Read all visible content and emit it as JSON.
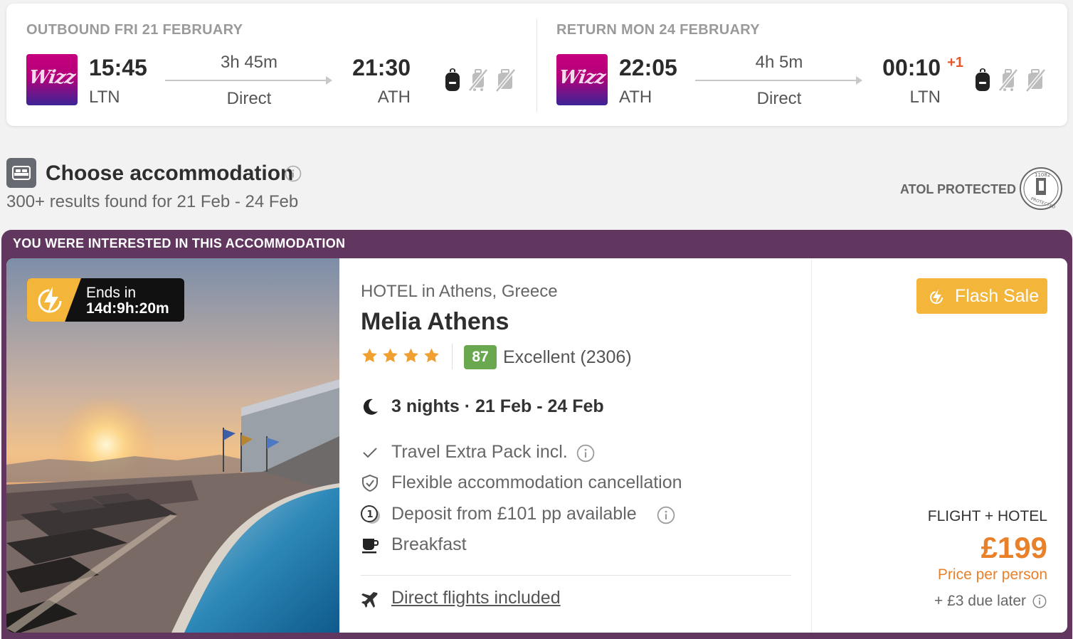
{
  "outbound": {
    "title": "OUTBOUND FRI 21 FEBRUARY",
    "airline_logo_text": "Wizz",
    "dep_time": "15:45",
    "dep_code": "LTN",
    "duration": "3h 45m",
    "stops": "Direct",
    "arr_time": "21:30",
    "arr_code": "ATH",
    "arr_plus": "",
    "icons": [
      "backpack-icon",
      "no-cabin-bag-icon",
      "no-checked-bag-icon"
    ]
  },
  "return": {
    "title": "RETURN MON 24 FEBRUARY",
    "airline_logo_text": "Wizz",
    "dep_time": "22:05",
    "dep_code": "ATH",
    "duration": "4h 5m",
    "stops": "Direct",
    "arr_time": "00:10",
    "arr_code": "LTN",
    "arr_plus": "+1",
    "icons": [
      "backpack-icon",
      "no-cabin-bag-icon",
      "no-checked-bag-icon"
    ]
  },
  "accommodation": {
    "title": "Choose accommodation",
    "results": "300+ results found for 21 Feb - 24 Feb",
    "atol": "ATOL PROTECTED",
    "atol_logo_text": "11082"
  },
  "card": {
    "interest_label": "YOU WERE INTERESTED IN THIS ACCOMMODATION",
    "timer_label": "Ends in",
    "timer_value": "14d:9h:20m",
    "hotel_type": "HOTEL in Athens, Greece",
    "hotel_name": "Melia Athens",
    "stars": 4,
    "rating_score": "87",
    "rating_text": "Excellent (2306)",
    "nights": "3 nights · 21 Feb - 24 Feb",
    "features": [
      {
        "icon": "check-icon",
        "text": "Travel Extra Pack incl.",
        "info": true
      },
      {
        "icon": "shield-check-icon",
        "text": "Flexible accommodation cancellation",
        "info": false
      },
      {
        "icon": "deposit-coin-icon",
        "text": "Deposit from £101 pp available",
        "info": true
      },
      {
        "icon": "coffee-cup-icon",
        "text": "Breakfast",
        "info": false
      }
    ],
    "flights_link": "Direct flights included",
    "flash_label": "Flash Sale",
    "package_label": "FLIGHT + HOTEL",
    "price": "£199",
    "price_sub": "Price per person",
    "due_later": "+ £3 due later"
  },
  "colors": {
    "accent_purple": "#61365f",
    "flash_yellow": "#f4b63a",
    "price_orange": "#e8812a",
    "rating_green": "#6aa84f",
    "plus_day_red": "#e8562a"
  }
}
